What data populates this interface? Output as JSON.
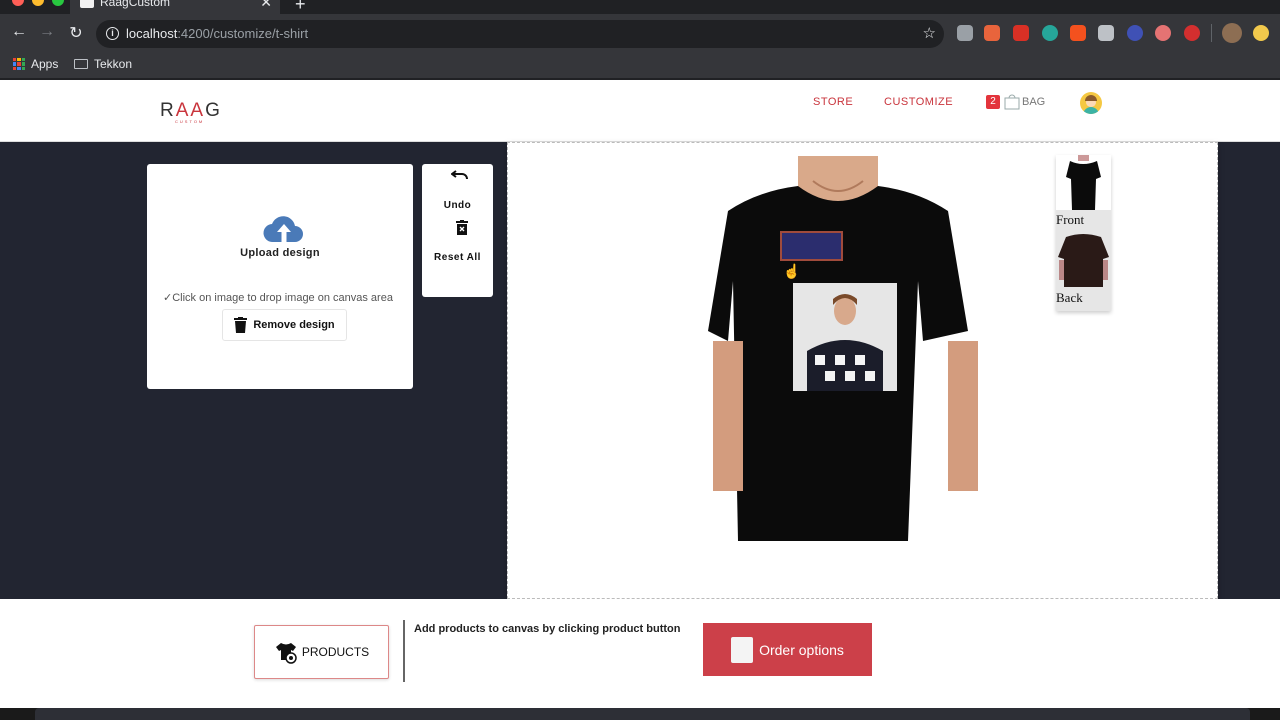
{
  "browser": {
    "tab_title": "RaagCustom",
    "url_host": "localhost",
    "url_path": ":4200/customize/t-shirt",
    "bookmarks": [
      {
        "label": "Apps",
        "icon": "apps-grid-icon"
      },
      {
        "label": "Tekkon",
        "icon": "folder-icon"
      }
    ],
    "extensions": [
      {
        "name": "cloud-ext-icon",
        "color": "#9aa0a6"
      },
      {
        "name": "extension-badge-icon",
        "color": "#e8643c"
      },
      {
        "name": "media-ext-icon",
        "color": "#d93025"
      },
      {
        "name": "m-ext-icon",
        "color": "#26a69a"
      },
      {
        "name": "percent-ext-icon",
        "color": "#f4511e"
      },
      {
        "name": "screen-ext-icon",
        "color": "#bdc1c6"
      },
      {
        "name": "circle-ext-icon",
        "color": "#3f51b5"
      },
      {
        "name": "plane-ext-icon",
        "color": "#e57373"
      },
      {
        "name": "hand-ext-icon",
        "color": "#d32f2f"
      }
    ]
  },
  "header": {
    "logo": {
      "pre": "R",
      "mid": "AA",
      "post": "G",
      "tag": "CUSTOM"
    },
    "nav": [
      {
        "label": "STORE"
      },
      {
        "label": "CUSTOMIZE"
      }
    ],
    "bag_count": "2",
    "bag_label": "BAG",
    "accent": "#c9343c"
  },
  "upload": {
    "label": "Upload design",
    "hint": "✓Click on image to drop image on canvas area",
    "remove_label": "Remove design"
  },
  "tools": {
    "undo_label": "Undo",
    "reset_label": "Reset All"
  },
  "views": [
    {
      "label": "Front"
    },
    {
      "label": "Back"
    }
  ],
  "bottom": {
    "products_label": "PRODUCTS",
    "add_hint": "Add products to canvas by clicking product button",
    "order_label": "Order options",
    "order_color": "#cc4049"
  }
}
